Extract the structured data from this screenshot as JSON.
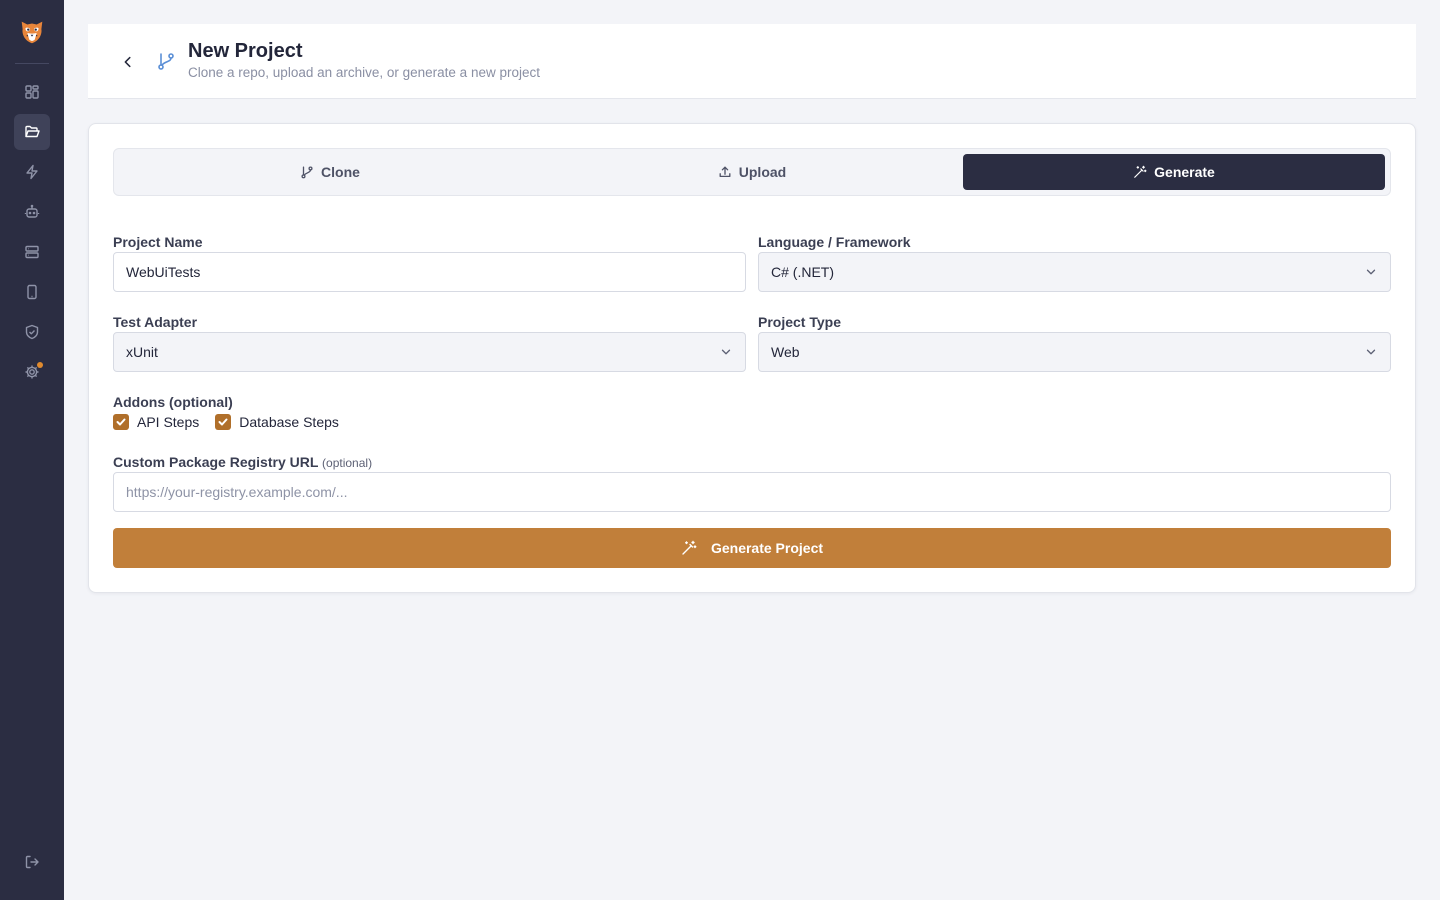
{
  "header": {
    "title": "New Project",
    "subtitle": "Clone a repo, upload an archive, or generate a new project"
  },
  "sidebar": {
    "items": [
      {
        "icon": "dashboard-icon",
        "active": false
      },
      {
        "icon": "folder-open-icon",
        "active": true
      },
      {
        "icon": "lightning-icon",
        "active": false
      },
      {
        "icon": "robot-icon",
        "active": false
      },
      {
        "icon": "server-icon",
        "active": false
      },
      {
        "icon": "mobile-icon",
        "active": false
      },
      {
        "icon": "shield-icon",
        "active": false
      },
      {
        "icon": "gear-icon",
        "active": false
      }
    ],
    "bottom_icon": "logout-icon"
  },
  "tabs": [
    {
      "label": "Clone",
      "icon": "git-branch-icon"
    },
    {
      "label": "Upload",
      "icon": "upload-icon"
    },
    {
      "label": "Generate",
      "icon": "magic-wand-icon",
      "active": true
    }
  ],
  "form": {
    "project_name": {
      "label": "Project Name",
      "value": "WebUiTests"
    },
    "language": {
      "label": "Language / Framework",
      "value": "C# (.NET)"
    },
    "test_adapter": {
      "label": "Test Adapter",
      "value": "xUnit"
    },
    "project_type": {
      "label": "Project Type",
      "value": "Web"
    },
    "addons": {
      "label": "Addons (optional)",
      "items": [
        {
          "label": "API Steps",
          "checked": true
        },
        {
          "label": "Database Steps",
          "checked": true
        }
      ]
    },
    "registry": {
      "label": "Custom Package Registry URL",
      "optional": "(optional)",
      "placeholder": "https://your-registry.example.com/..."
    },
    "submit_label": "Generate Project"
  },
  "colors": {
    "sidebar": "#2b2d42",
    "accent": "#c17f3a",
    "checkbox": "#b06f2a",
    "notification_dot": "#e08a2e"
  }
}
